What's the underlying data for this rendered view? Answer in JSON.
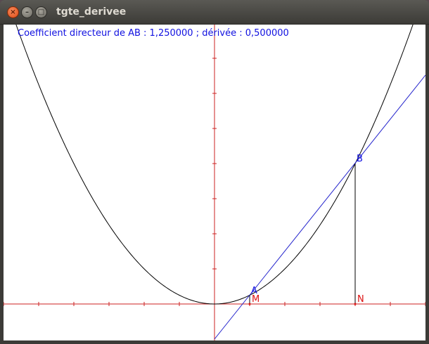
{
  "window": {
    "title": "tgte_derivee",
    "close_glyph": "×",
    "min_glyph": "–",
    "max_glyph": "□"
  },
  "info": {
    "text": "Coefficient directeur de AB : 1,250000 ; dérivée : 0,500000"
  },
  "points": {
    "A": "A",
    "B": "B",
    "M": "M",
    "N": "N"
  },
  "colors": {
    "axis": "#cc2222",
    "curve": "#000000",
    "secant": "#2222cc",
    "label_blue": "#1010e0",
    "label_red": "#dd1111"
  }
}
